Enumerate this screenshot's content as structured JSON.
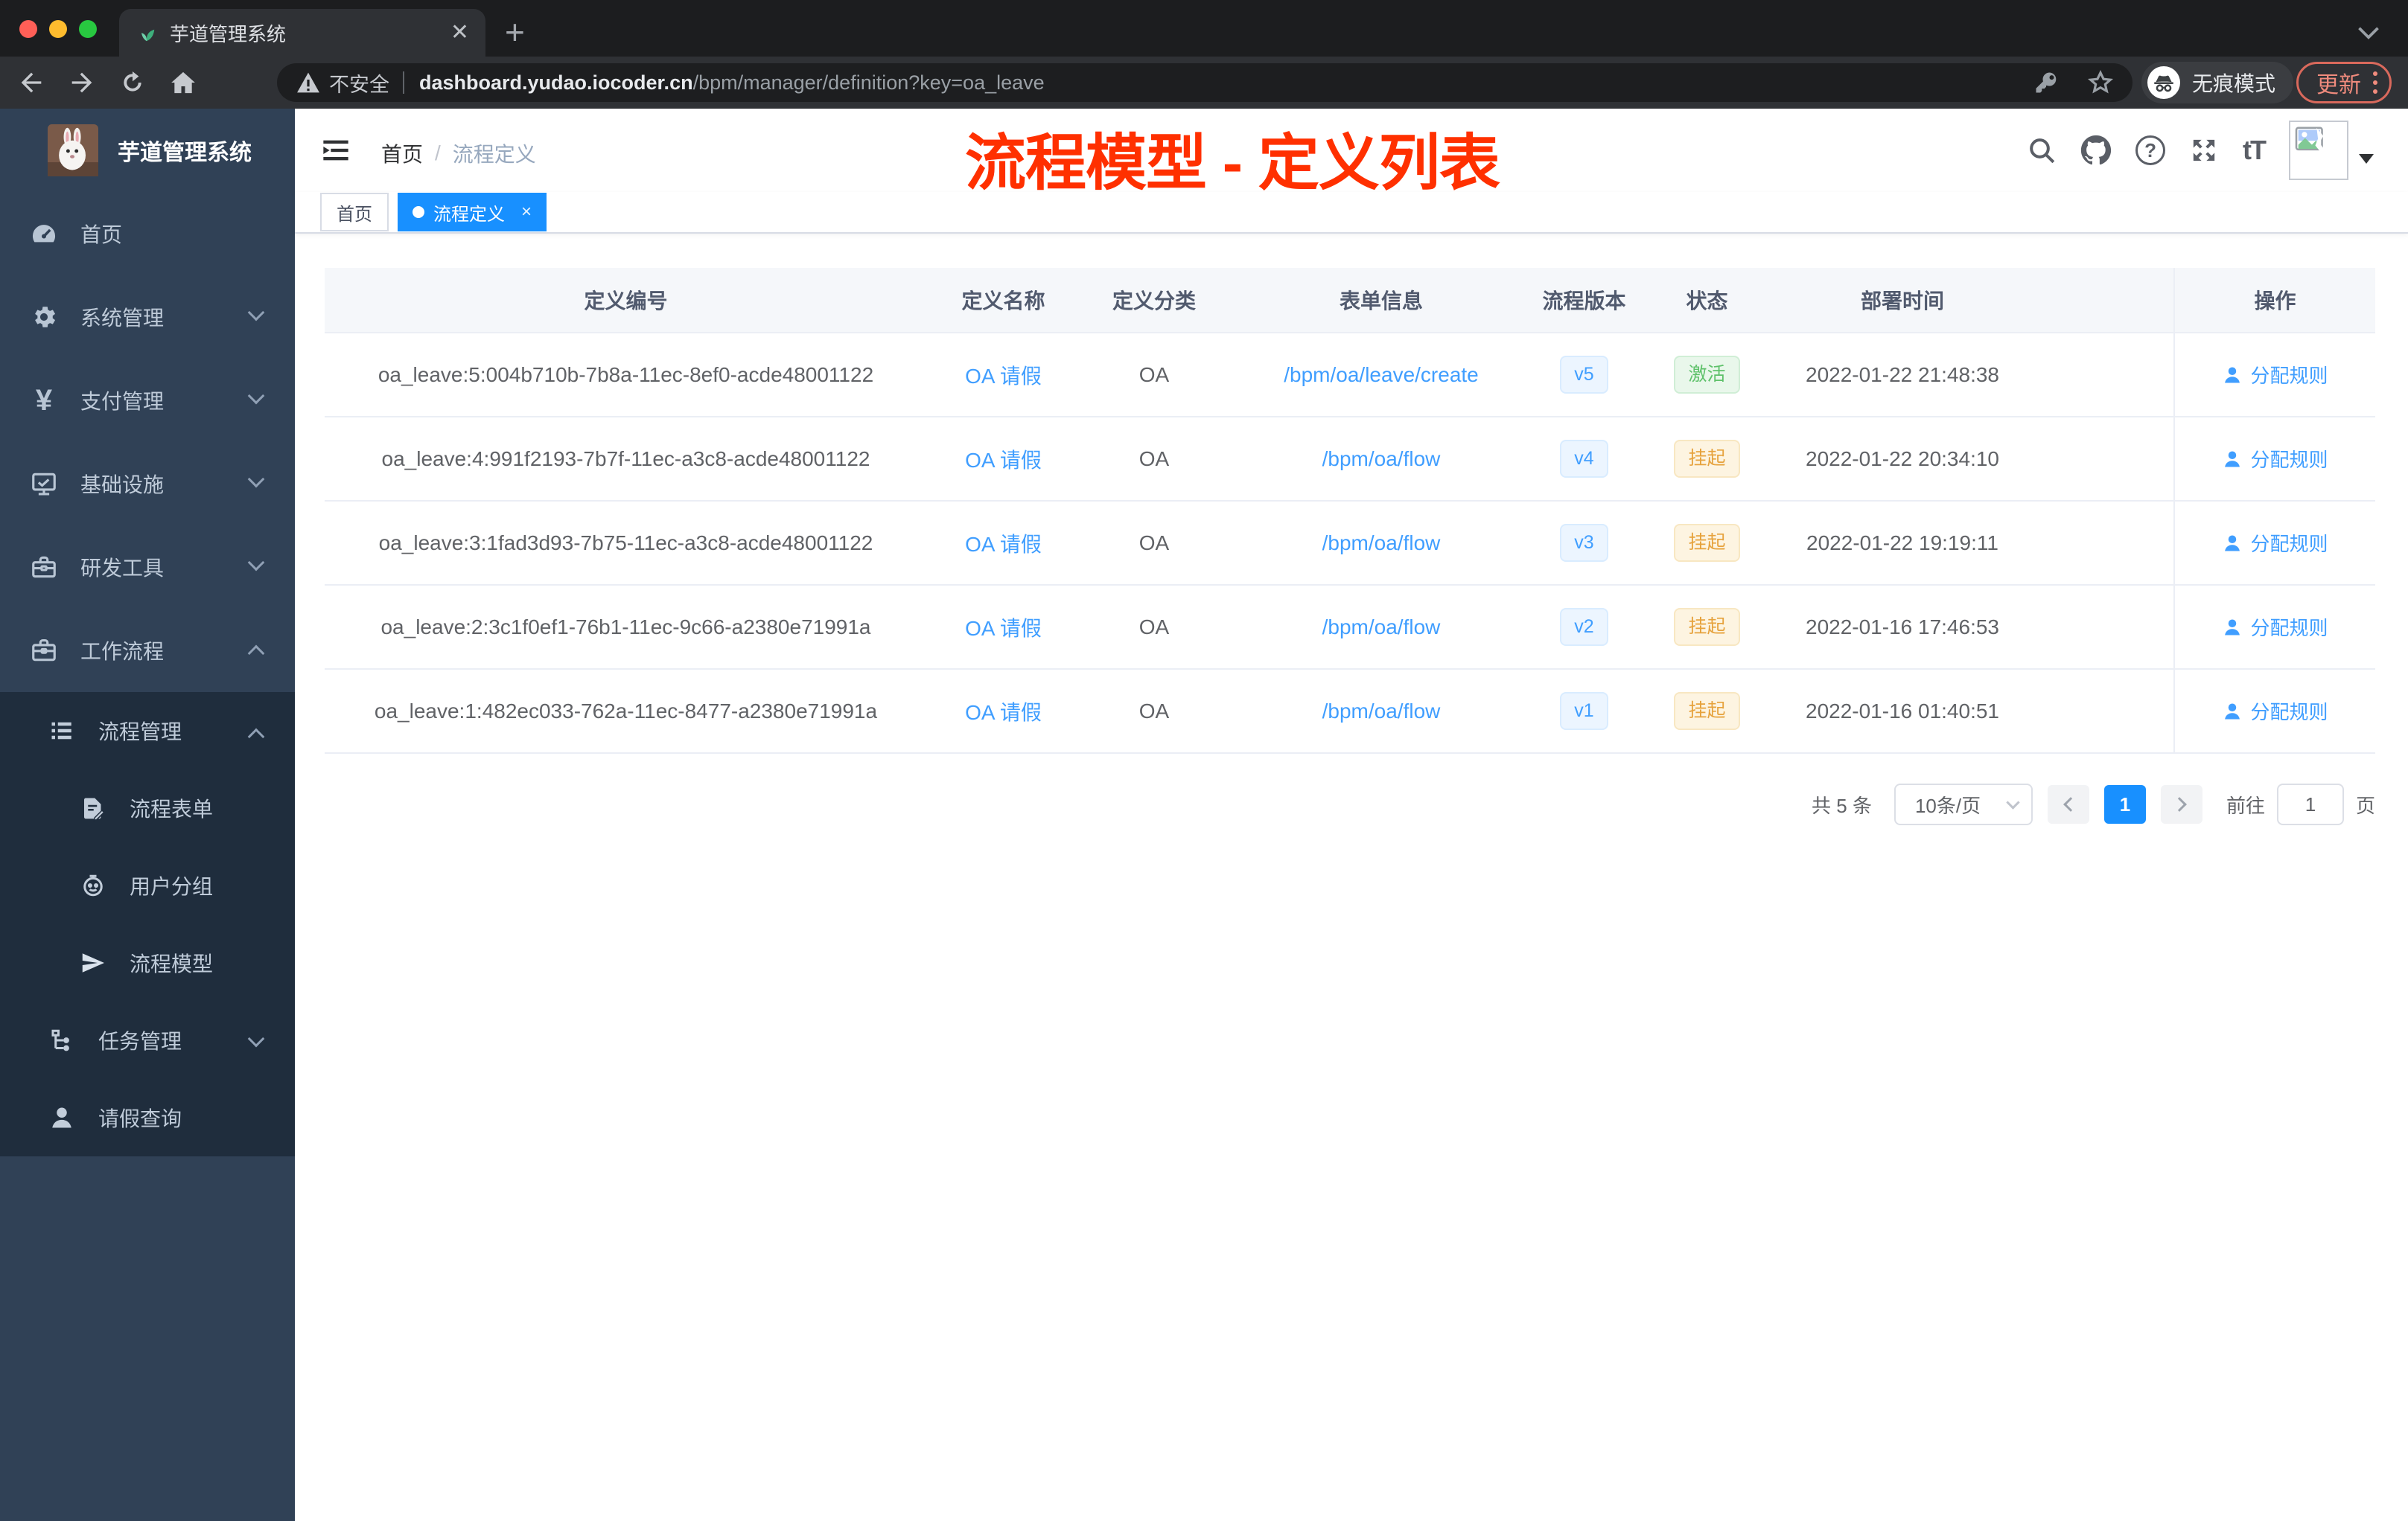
{
  "colors": {
    "tag_active": "#1890ff",
    "link": "#409eff",
    "annotation": "#ff3000",
    "sidebar_bg": "#304156",
    "submenu_bg": "#1f2d3d"
  },
  "browser": {
    "tab_title": "芋道管理系统",
    "new_tab_label": "+",
    "security_label": "不安全",
    "url_host": "dashboard.yudao.iocoder.cn",
    "url_path": "/bpm/manager/definition?key=oa_leave",
    "incognito_label": "无痕模式",
    "update_label": "更新"
  },
  "icons": {
    "favicon": "green-sprout",
    "tab_close": "close-x",
    "back": "arrow-left",
    "forward": "arrow-right",
    "reload": "reload-circle",
    "home": "house",
    "security": "warning-triangle",
    "passwords": "key",
    "bookmark": "star-outline",
    "incognito": "spy-hat-glasses",
    "menu_dots": "vertical-ellipsis",
    "navbar_right": [
      "search-magnifier",
      "github-octocat",
      "question-circle",
      "fullscreen-expand",
      "font-size-tT"
    ],
    "avatar": "broken-image-placeholder"
  },
  "sidebar": {
    "logo_title": "芋道管理系统",
    "menu": [
      {
        "label": "首页",
        "icon": "dashboard-gauge",
        "arrow": "none"
      },
      {
        "label": "系统管理",
        "icon": "gear",
        "arrow": "down"
      },
      {
        "label": "支付管理",
        "icon": "yen",
        "arrow": "down"
      },
      {
        "label": "基础设施",
        "icon": "monitor-check",
        "arrow": "down"
      },
      {
        "label": "研发工具",
        "icon": "toolbox",
        "arrow": "down"
      },
      {
        "label": "工作流程",
        "icon": "briefcase",
        "arrow": "up"
      }
    ],
    "submenu": [
      {
        "label": "流程管理",
        "icon": "tree-list",
        "arrow": "up",
        "level": 1
      },
      {
        "label": "流程表单",
        "icon": "document-edit",
        "arrow": "none",
        "level": 2
      },
      {
        "label": "用户分组",
        "icon": "robot-face",
        "arrow": "none",
        "level": 2
      },
      {
        "label": "流程模型",
        "icon": "paper-plane",
        "arrow": "none",
        "level": 2
      },
      {
        "label": "任务管理",
        "icon": "org-tree",
        "arrow": "down",
        "level": 1
      },
      {
        "label": "请假查询",
        "icon": "person",
        "arrow": "none",
        "level": 1
      }
    ]
  },
  "navbar": {
    "breadcrumb": {
      "home": "首页",
      "separator": "/",
      "current": "流程定义"
    }
  },
  "annotation": {
    "text": "流程模型 - 定义列表"
  },
  "tags": {
    "home": "首页",
    "active": "流程定义",
    "close": "×"
  },
  "table": {
    "columns": [
      "定义编号",
      "定义名称",
      "定义分类",
      "表单信息",
      "流程版本",
      "状态",
      "部署时间",
      "操作"
    ],
    "rows": [
      {
        "id": "oa_leave:5:004b710b-7b8a-11ec-8ef0-acde48001122",
        "name": "OA 请假",
        "category": "OA",
        "form": "/bpm/oa/leave/create",
        "version": "v5",
        "status": "激活",
        "status_type": "success",
        "deployed_at": "2022-01-22 21:48:38",
        "action": "分配规则"
      },
      {
        "id": "oa_leave:4:991f2193-7b7f-11ec-a3c8-acde48001122",
        "name": "OA 请假",
        "category": "OA",
        "form": "/bpm/oa/flow",
        "version": "v4",
        "status": "挂起",
        "status_type": "warning",
        "deployed_at": "2022-01-22 20:34:10",
        "action": "分配规则"
      },
      {
        "id": "oa_leave:3:1fad3d93-7b75-11ec-a3c8-acde48001122",
        "name": "OA 请假",
        "category": "OA",
        "form": "/bpm/oa/flow",
        "version": "v3",
        "status": "挂起",
        "status_type": "warning",
        "deployed_at": "2022-01-22 19:19:11",
        "action": "分配规则"
      },
      {
        "id": "oa_leave:2:3c1f0ef1-76b1-11ec-9c66-a2380e71991a",
        "name": "OA 请假",
        "category": "OA",
        "form": "/bpm/oa/flow",
        "version": "v2",
        "status": "挂起",
        "status_type": "warning",
        "deployed_at": "2022-01-16 17:46:53",
        "action": "分配规则"
      },
      {
        "id": "oa_leave:1:482ec033-762a-11ec-8477-a2380e71991a",
        "name": "OA 请假",
        "category": "OA",
        "form": "/bpm/oa/flow",
        "version": "v1",
        "status": "挂起",
        "status_type": "warning",
        "deployed_at": "2022-01-16 01:40:51",
        "action": "分配规则"
      }
    ]
  },
  "pagination": {
    "total": "共 5 条",
    "page_size": "10条/页",
    "page": "1",
    "goto_label": "前往",
    "goto_value": "1",
    "goto_suffix": "页"
  }
}
